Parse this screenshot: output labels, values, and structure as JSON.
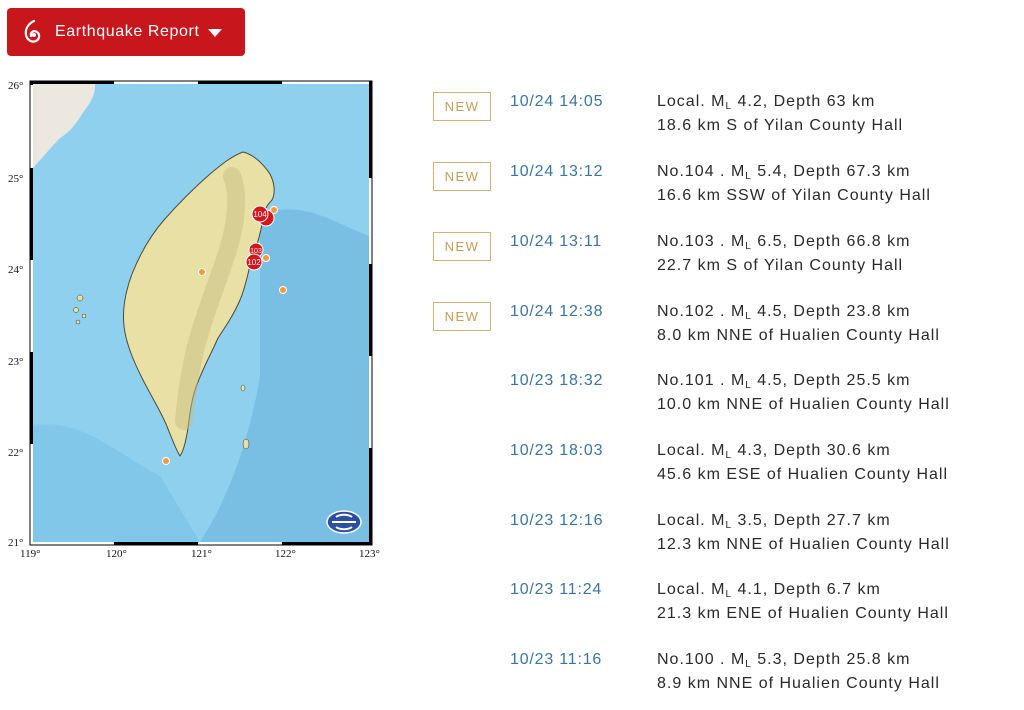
{
  "header": {
    "button_label": "Earthquake Report"
  },
  "map": {
    "lat_labels": [
      "26°",
      "25°",
      "24°",
      "23°",
      "22°",
      "21°"
    ],
    "lon_labels": [
      "119°",
      "120°",
      "121°",
      "122°",
      "123°"
    ],
    "markers": [
      {
        "label": "104"
      },
      {
        "label": "103"
      },
      {
        "label": "102"
      }
    ],
    "colors": {
      "sea": "#8fd0ef",
      "land": "#e9e0a6",
      "marker_big": "#d7141c",
      "marker_small": "#f29a3a"
    }
  },
  "events": [
    {
      "badge": "NEW",
      "time": "10/24 14:05",
      "prefix": "Local. ",
      "magnitude": " 4.2, Depth 63 km",
      "location": "18.6 km S of Yilan County Hall"
    },
    {
      "badge": "NEW",
      "time": "10/24 13:12",
      "prefix": "No.104 . ",
      "magnitude": " 5.4, Depth 67.3 km",
      "location": "16.6 km SSW of Yilan County Hall"
    },
    {
      "badge": "NEW",
      "time": "10/24 13:11",
      "prefix": "No.103 . ",
      "magnitude": " 6.5, Depth 66.8 km",
      "location": "22.7 km S of Yilan County Hall"
    },
    {
      "badge": "NEW",
      "time": "10/24 12:38",
      "prefix": "No.102 . ",
      "magnitude": " 4.5, Depth 23.8 km",
      "location": "8.0 km NNE of Hualien County Hall"
    },
    {
      "badge": "",
      "time": "10/23 18:32",
      "prefix": "No.101 . ",
      "magnitude": " 4.5, Depth 25.5 km",
      "location": "10.0 km NNE of Hualien County Hall"
    },
    {
      "badge": "",
      "time": "10/23 18:03",
      "prefix": "Local. ",
      "magnitude": " 4.3, Depth 30.6 km",
      "location": "45.6 km ESE of Hualien County Hall"
    },
    {
      "badge": "",
      "time": "10/23 12:16",
      "prefix": "Local. ",
      "magnitude": " 3.5, Depth 27.7 km",
      "location": "12.3 km NNE of Hualien County Hall"
    },
    {
      "badge": "",
      "time": "10/23 11:24",
      "prefix": "Local. ",
      "magnitude": " 4.1, Depth 6.7 km",
      "location": "21.3 km ENE of Hualien County Hall"
    },
    {
      "badge": "",
      "time": "10/23 11:16",
      "prefix": "No.100 . ",
      "magnitude": " 5.3, Depth 25.8 km",
      "location": "8.9 km NNE of Hualien County Hall"
    }
  ],
  "ml_symbol": "M",
  "ml_sub": "L"
}
